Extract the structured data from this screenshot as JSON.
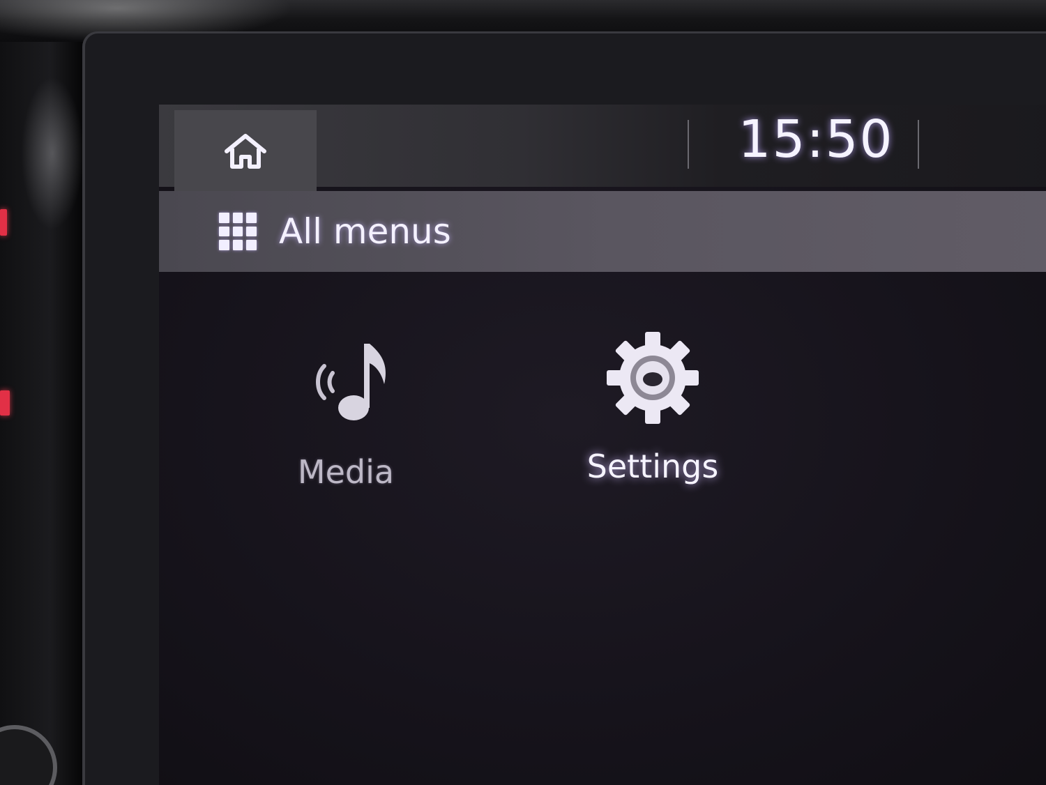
{
  "top_bar": {
    "home_icon": "home-icon",
    "clock": "15:50"
  },
  "header": {
    "icon": "grid-icon",
    "title": "All menus"
  },
  "menu_items": [
    {
      "label": "Media",
      "icon": "music-note-icon"
    },
    {
      "label": "Settings",
      "icon": "gear-icon"
    }
  ],
  "colors": {
    "text_glow": "#f4f1ff",
    "screen_bg": "#16131b",
    "accent_red": "#e23046"
  }
}
